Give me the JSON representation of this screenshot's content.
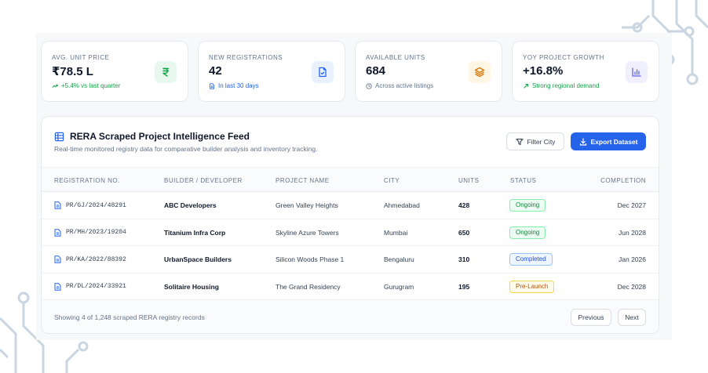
{
  "stats": [
    {
      "label": "AVG. UNIT PRICE",
      "value": "₹78.5 L",
      "sub": "+5.4% vs last quarter",
      "sub_color": "#16a34a",
      "icon": "rupee-icon",
      "icon_bg": "#e8f8ef",
      "icon_color": "#16a34a"
    },
    {
      "label": "NEW REGISTRATIONS",
      "value": "42",
      "sub": "In last 30 days",
      "sub_color": "#2563eb",
      "icon": "document-check-icon",
      "icon_bg": "#eaf1fe",
      "icon_color": "#2563eb"
    },
    {
      "label": "AVAILABLE UNITS",
      "value": "684",
      "sub": "Across active listings",
      "sub_color": "#64748b",
      "icon": "layers-icon",
      "icon_bg": "#fef6e4",
      "icon_color": "#d97706"
    },
    {
      "label": "YOY PROJECT GROWTH",
      "value": "+16.8%",
      "sub": "Strong regional demand",
      "sub_color": "#16a34a",
      "icon": "bar-chart-icon",
      "icon_bg": "#efeffd",
      "icon_color": "#6366f1"
    }
  ],
  "panel": {
    "title": "RERA Scraped Project Intelligence Feed",
    "subtitle": "Real-time monitored registry data for comparative builder analysis and inventory tracking.",
    "filter_label": "Filter City",
    "export_label": "Export Dataset"
  },
  "table": {
    "columns": [
      "REGISTRATION NO.",
      "BUILDER / DEVELOPER",
      "PROJECT NAME",
      "CITY",
      "UNITS",
      "STATUS",
      "COMPLETION"
    ],
    "rows": [
      {
        "reg": "PR/GJ/2024/48291",
        "builder": "ABC Developers",
        "project": "Green Valley Heights",
        "city": "Ahmedabad",
        "units": "428",
        "status": "Ongoing",
        "completion": "Dec 2027"
      },
      {
        "reg": "PR/MH/2023/19204",
        "builder": "Titanium Infra Corp",
        "project": "Skyline Azure Towers",
        "city": "Mumbai",
        "units": "650",
        "status": "Ongoing",
        "completion": "Jun 2028"
      },
      {
        "reg": "PR/KA/2022/88392",
        "builder": "UrbanSpace Builders",
        "project": "Silicon Woods Phase 1",
        "city": "Bengaluru",
        "units": "310",
        "status": "Completed",
        "completion": "Jan 2026"
      },
      {
        "reg": "PR/DL/2024/33921",
        "builder": "Solitaire Housing",
        "project": "The Grand Residency",
        "city": "Gurugram",
        "units": "195",
        "status": "Pre-Launch",
        "completion": "Dec 2028"
      }
    ]
  },
  "status_styles": {
    "Ongoing": {
      "bg": "#ecfdf3",
      "border": "#86efac",
      "color": "#15803d"
    },
    "Completed": {
      "bg": "#eff6ff",
      "border": "#93c5fd",
      "color": "#1d4ed8"
    },
    "Pre-Launch": {
      "bg": "#fffbeb",
      "border": "#fcd34d",
      "color": "#b45309"
    }
  },
  "footer": {
    "text": "Showing 4 of 1,248 scraped RERA registry records",
    "previous_label": "Previous",
    "next_label": "Next"
  },
  "colors": {
    "accent": "#2563eb",
    "decor": "#c9d6e2"
  }
}
